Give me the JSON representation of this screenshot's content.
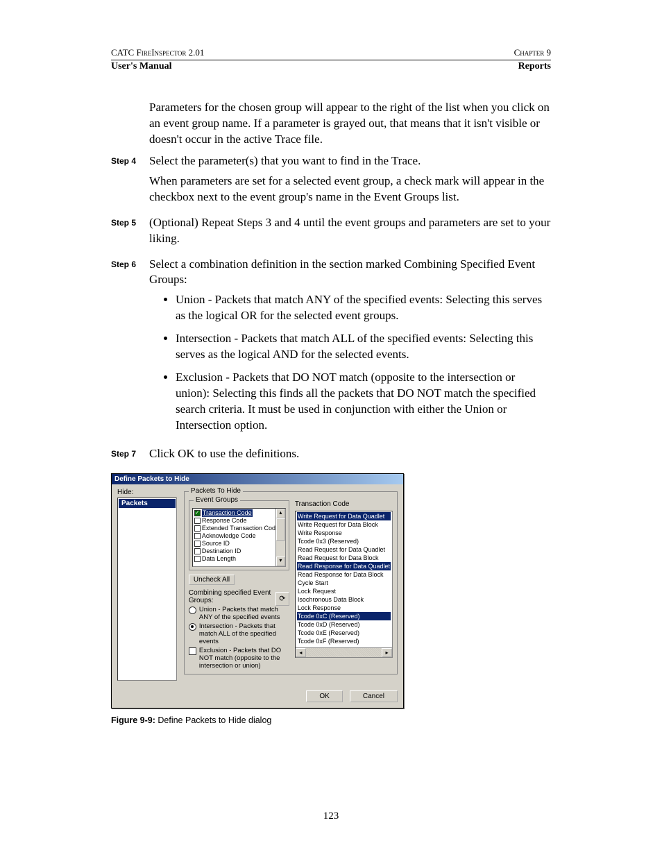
{
  "header": {
    "leftTop": "CATC FireInspector 2.01",
    "rightTop": "Chapter 9",
    "leftBold": "User's Manual",
    "rightBold": "Reports"
  },
  "intro": "Parameters for the chosen group will appear to the right of the list when you click on an event group name. If a parameter is grayed out, that means that it isn't visible or doesn't occur in the active Trace file.",
  "step4": {
    "label": "Step 4",
    "line1": "Select the parameter(s) that you want to find in the Trace.",
    "line2": "When parameters are set for a selected event group, a check mark will appear in the checkbox next to the event group's name in the Event Groups list."
  },
  "step5": {
    "label": "Step 5",
    "line": "(Optional) Repeat Steps 3 and 4 until the event groups and parameters are set to your liking."
  },
  "step6": {
    "label": "Step 6",
    "intro": "Select a combination definition in the section marked Combining Specified Event Groups:",
    "b1": "Union - Packets that match ANY of the specified events: Selecting this serves as the logical OR for the selected event groups.",
    "b2": "Intersection - Packets that match ALL of the specified events: Selecting this serves as the logical AND for the selected events.",
    "b3": "Exclusion - Packets that DO NOT match (opposite to the intersection or union): Selecting this finds all the packets that DO NOT match the specified search criteria. It must be used in conjunction with either the Union or Intersection option."
  },
  "step7": {
    "label": "Step 7",
    "line": "Click OK to use the definitions."
  },
  "dialog": {
    "title": "Define Packets to Hide",
    "hideLabel": "Hide:",
    "hideItem": "Packets",
    "packetsToHide": "Packets To Hide",
    "eventGroups": "Event Groups",
    "egItems": {
      "i0": "Transaction Code",
      "i1": "Response Code",
      "i2": "Extended Transaction Code",
      "i3": "Acknowledge Code",
      "i4": "Source ID",
      "i5": "Destination ID",
      "i6": "Data Length"
    },
    "uncheckAll": "Uncheck All",
    "combineLabel": "Combining specified Event Groups:",
    "optUnion": "Union - Packets that match ANY of the specified events",
    "optIntersection": "Intersection - Packets that match ALL of the specified events",
    "optExclusion": "Exclusion - Packets that DO NOT match (opposite to the intersection or union)",
    "tcTitle": "Transaction Code",
    "tcItems": {
      "t0": "Write Request for Data Quadlet",
      "t1": "Write Request for Data Block",
      "t2": "Write Response",
      "t3": "Tcode 0x3 (Reserved)",
      "t4": "Read Request for Data Quadlet",
      "t5": "Read Request for Data Block",
      "t6": "Read Response for Data Quadlet",
      "t7": "Read Response for Data Block",
      "t8": "Cycle Start",
      "t9": "Lock Request",
      "t10": "Isochronous Data Block",
      "t11": "Lock Response",
      "t12": "Tcode 0xC (Reserved)",
      "t13": "Tcode 0xD (Reserved)",
      "t14": "Tcode 0xE (Reserved)",
      "t15": "Tcode 0xF (Reserved)"
    },
    "ok": "OK",
    "cancel": "Cancel"
  },
  "figure": {
    "label": "Figure 9-9:",
    "text": "  Define Packets to Hide dialog"
  },
  "pageNumber": "123"
}
